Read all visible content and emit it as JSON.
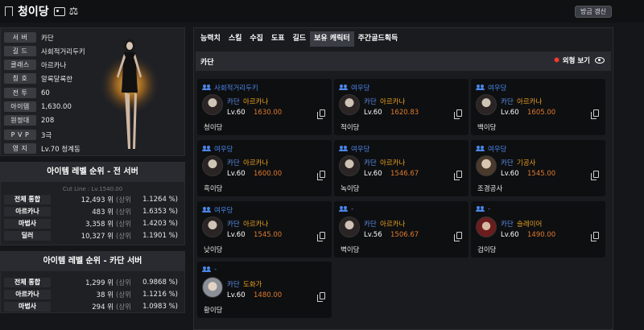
{
  "header": {
    "title": "청이당",
    "refresh_label": "방금 갱신"
  },
  "profile": {
    "rows": [
      {
        "label": "서 버",
        "value": "카단"
      },
      {
        "label": "길 드",
        "value": "사회적거리두키"
      },
      {
        "label": "클래스",
        "value": "아르카나"
      },
      {
        "label": "칭 호",
        "value": "알록달록한"
      },
      {
        "label": "전 투",
        "value": "60"
      },
      {
        "label": "아이템",
        "value": "1,630.00"
      },
      {
        "label": "원정대",
        "value": "208"
      },
      {
        "label": "P V P",
        "value": "3극"
      },
      {
        "label": "영 지",
        "value": "Lv.70 청계동"
      }
    ]
  },
  "rank_all": {
    "title": "아이템 레벨 순위 - 전 서버",
    "cutline": "Cut Line : Lv.1540.00",
    "rows": [
      {
        "label": "전체 통합",
        "rank": "12,493 위",
        "sub": "(상위",
        "pct": "1.1264 %)"
      },
      {
        "label": "아르카나",
        "rank": "483 위",
        "sub": "(상위",
        "pct": "1.6353 %)"
      },
      {
        "label": "마법사",
        "rank": "3,358 위",
        "sub": "(상위",
        "pct": "1.4203 %)"
      },
      {
        "label": "딜러",
        "rank": "10,327 위",
        "sub": "(상위",
        "pct": "1.1901 %)"
      }
    ]
  },
  "rank_server": {
    "title": "아이템 레벨 순위 - 카단 서버",
    "rows": [
      {
        "label": "전체 통합",
        "rank": "1,299 위",
        "sub": "(상위",
        "pct": "0.9868 %)"
      },
      {
        "label": "아르카나",
        "rank": "38 위",
        "sub": "(상위",
        "pct": "1.1216 %)"
      },
      {
        "label": "마법사",
        "rank": "294 위",
        "sub": "(상위",
        "pct": "1.0983 %)"
      }
    ]
  },
  "tabs": [
    "능력치",
    "스킬",
    "수집",
    "도표",
    "길드",
    "보유 캐릭터",
    "주간골드획득"
  ],
  "server_bar": {
    "name": "카단",
    "look_label": "외형 보기"
  },
  "characters": [
    {
      "guild": "사회적거리두키",
      "server": "카단",
      "class": "아르카나",
      "level": "Lv.60",
      "item_level": "1630.00",
      "name": "청이당"
    },
    {
      "guild": "여우당",
      "server": "카단",
      "class": "아르카나",
      "level": "Lv.60",
      "item_level": "1620.83",
      "name": "적이당"
    },
    {
      "guild": "여우당",
      "server": "카단",
      "class": "아르카나",
      "level": "Lv.60",
      "item_level": "1605.00",
      "name": "백이당"
    },
    {
      "guild": "여우당",
      "server": "카단",
      "class": "아르카나",
      "level": "Lv.60",
      "item_level": "1600.00",
      "name": "흑이당"
    },
    {
      "guild": "여우당",
      "server": "카단",
      "class": "아르카나",
      "level": "Lv.60",
      "item_level": "1546.67",
      "name": "녹이당"
    },
    {
      "guild": "여우당",
      "server": "카단",
      "class": "기공사",
      "level": "Lv.60",
      "item_level": "1545.00",
      "name": "조경공사"
    },
    {
      "guild": "여우당",
      "server": "카단",
      "class": "아르카나",
      "level": "Lv.60",
      "item_level": "1545.00",
      "name": "낮이당"
    },
    {
      "guild": "-",
      "server": "카단",
      "class": "아르카나",
      "level": "Lv.56",
      "item_level": "1506.67",
      "name": "벽이당"
    },
    {
      "guild": "-",
      "server": "카단",
      "class": "슬레이어",
      "level": "Lv.60",
      "item_level": "1490.00",
      "name": "검이당"
    },
    {
      "guild": "-",
      "server": "카단",
      "class": "도화가",
      "level": "Lv.60",
      "item_level": "1480.00",
      "name": "황이당"
    }
  ]
}
